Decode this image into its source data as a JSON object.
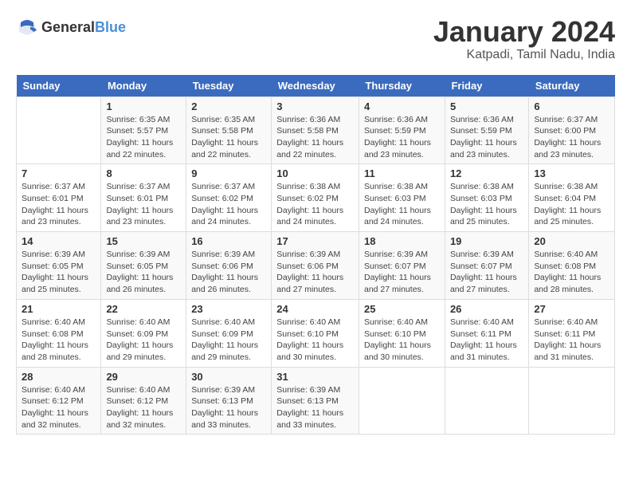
{
  "header": {
    "logo_general": "General",
    "logo_blue": "Blue",
    "title": "January 2024",
    "subtitle": "Katpadi, Tamil Nadu, India"
  },
  "calendar": {
    "days_of_week": [
      "Sunday",
      "Monday",
      "Tuesday",
      "Wednesday",
      "Thursday",
      "Friday",
      "Saturday"
    ],
    "weeks": [
      [
        {
          "num": "",
          "sunrise": "",
          "sunset": "",
          "daylight": ""
        },
        {
          "num": "1",
          "sunrise": "Sunrise: 6:35 AM",
          "sunset": "Sunset: 5:57 PM",
          "daylight": "Daylight: 11 hours and 22 minutes."
        },
        {
          "num": "2",
          "sunrise": "Sunrise: 6:35 AM",
          "sunset": "Sunset: 5:58 PM",
          "daylight": "Daylight: 11 hours and 22 minutes."
        },
        {
          "num": "3",
          "sunrise": "Sunrise: 6:36 AM",
          "sunset": "Sunset: 5:58 PM",
          "daylight": "Daylight: 11 hours and 22 minutes."
        },
        {
          "num": "4",
          "sunrise": "Sunrise: 6:36 AM",
          "sunset": "Sunset: 5:59 PM",
          "daylight": "Daylight: 11 hours and 23 minutes."
        },
        {
          "num": "5",
          "sunrise": "Sunrise: 6:36 AM",
          "sunset": "Sunset: 5:59 PM",
          "daylight": "Daylight: 11 hours and 23 minutes."
        },
        {
          "num": "6",
          "sunrise": "Sunrise: 6:37 AM",
          "sunset": "Sunset: 6:00 PM",
          "daylight": "Daylight: 11 hours and 23 minutes."
        }
      ],
      [
        {
          "num": "7",
          "sunrise": "Sunrise: 6:37 AM",
          "sunset": "Sunset: 6:01 PM",
          "daylight": "Daylight: 11 hours and 23 minutes."
        },
        {
          "num": "8",
          "sunrise": "Sunrise: 6:37 AM",
          "sunset": "Sunset: 6:01 PM",
          "daylight": "Daylight: 11 hours and 23 minutes."
        },
        {
          "num": "9",
          "sunrise": "Sunrise: 6:37 AM",
          "sunset": "Sunset: 6:02 PM",
          "daylight": "Daylight: 11 hours and 24 minutes."
        },
        {
          "num": "10",
          "sunrise": "Sunrise: 6:38 AM",
          "sunset": "Sunset: 6:02 PM",
          "daylight": "Daylight: 11 hours and 24 minutes."
        },
        {
          "num": "11",
          "sunrise": "Sunrise: 6:38 AM",
          "sunset": "Sunset: 6:03 PM",
          "daylight": "Daylight: 11 hours and 24 minutes."
        },
        {
          "num": "12",
          "sunrise": "Sunrise: 6:38 AM",
          "sunset": "Sunset: 6:03 PM",
          "daylight": "Daylight: 11 hours and 25 minutes."
        },
        {
          "num": "13",
          "sunrise": "Sunrise: 6:38 AM",
          "sunset": "Sunset: 6:04 PM",
          "daylight": "Daylight: 11 hours and 25 minutes."
        }
      ],
      [
        {
          "num": "14",
          "sunrise": "Sunrise: 6:39 AM",
          "sunset": "Sunset: 6:05 PM",
          "daylight": "Daylight: 11 hours and 25 minutes."
        },
        {
          "num": "15",
          "sunrise": "Sunrise: 6:39 AM",
          "sunset": "Sunset: 6:05 PM",
          "daylight": "Daylight: 11 hours and 26 minutes."
        },
        {
          "num": "16",
          "sunrise": "Sunrise: 6:39 AM",
          "sunset": "Sunset: 6:06 PM",
          "daylight": "Daylight: 11 hours and 26 minutes."
        },
        {
          "num": "17",
          "sunrise": "Sunrise: 6:39 AM",
          "sunset": "Sunset: 6:06 PM",
          "daylight": "Daylight: 11 hours and 27 minutes."
        },
        {
          "num": "18",
          "sunrise": "Sunrise: 6:39 AM",
          "sunset": "Sunset: 6:07 PM",
          "daylight": "Daylight: 11 hours and 27 minutes."
        },
        {
          "num": "19",
          "sunrise": "Sunrise: 6:39 AM",
          "sunset": "Sunset: 6:07 PM",
          "daylight": "Daylight: 11 hours and 27 minutes."
        },
        {
          "num": "20",
          "sunrise": "Sunrise: 6:40 AM",
          "sunset": "Sunset: 6:08 PM",
          "daylight": "Daylight: 11 hours and 28 minutes."
        }
      ],
      [
        {
          "num": "21",
          "sunrise": "Sunrise: 6:40 AM",
          "sunset": "Sunset: 6:08 PM",
          "daylight": "Daylight: 11 hours and 28 minutes."
        },
        {
          "num": "22",
          "sunrise": "Sunrise: 6:40 AM",
          "sunset": "Sunset: 6:09 PM",
          "daylight": "Daylight: 11 hours and 29 minutes."
        },
        {
          "num": "23",
          "sunrise": "Sunrise: 6:40 AM",
          "sunset": "Sunset: 6:09 PM",
          "daylight": "Daylight: 11 hours and 29 minutes."
        },
        {
          "num": "24",
          "sunrise": "Sunrise: 6:40 AM",
          "sunset": "Sunset: 6:10 PM",
          "daylight": "Daylight: 11 hours and 30 minutes."
        },
        {
          "num": "25",
          "sunrise": "Sunrise: 6:40 AM",
          "sunset": "Sunset: 6:10 PM",
          "daylight": "Daylight: 11 hours and 30 minutes."
        },
        {
          "num": "26",
          "sunrise": "Sunrise: 6:40 AM",
          "sunset": "Sunset: 6:11 PM",
          "daylight": "Daylight: 11 hours and 31 minutes."
        },
        {
          "num": "27",
          "sunrise": "Sunrise: 6:40 AM",
          "sunset": "Sunset: 6:11 PM",
          "daylight": "Daylight: 11 hours and 31 minutes."
        }
      ],
      [
        {
          "num": "28",
          "sunrise": "Sunrise: 6:40 AM",
          "sunset": "Sunset: 6:12 PM",
          "daylight": "Daylight: 11 hours and 32 minutes."
        },
        {
          "num": "29",
          "sunrise": "Sunrise: 6:40 AM",
          "sunset": "Sunset: 6:12 PM",
          "daylight": "Daylight: 11 hours and 32 minutes."
        },
        {
          "num": "30",
          "sunrise": "Sunrise: 6:39 AM",
          "sunset": "Sunset: 6:13 PM",
          "daylight": "Daylight: 11 hours and 33 minutes."
        },
        {
          "num": "31",
          "sunrise": "Sunrise: 6:39 AM",
          "sunset": "Sunset: 6:13 PM",
          "daylight": "Daylight: 11 hours and 33 minutes."
        },
        {
          "num": "",
          "sunrise": "",
          "sunset": "",
          "daylight": ""
        },
        {
          "num": "",
          "sunrise": "",
          "sunset": "",
          "daylight": ""
        },
        {
          "num": "",
          "sunrise": "",
          "sunset": "",
          "daylight": ""
        }
      ]
    ]
  }
}
